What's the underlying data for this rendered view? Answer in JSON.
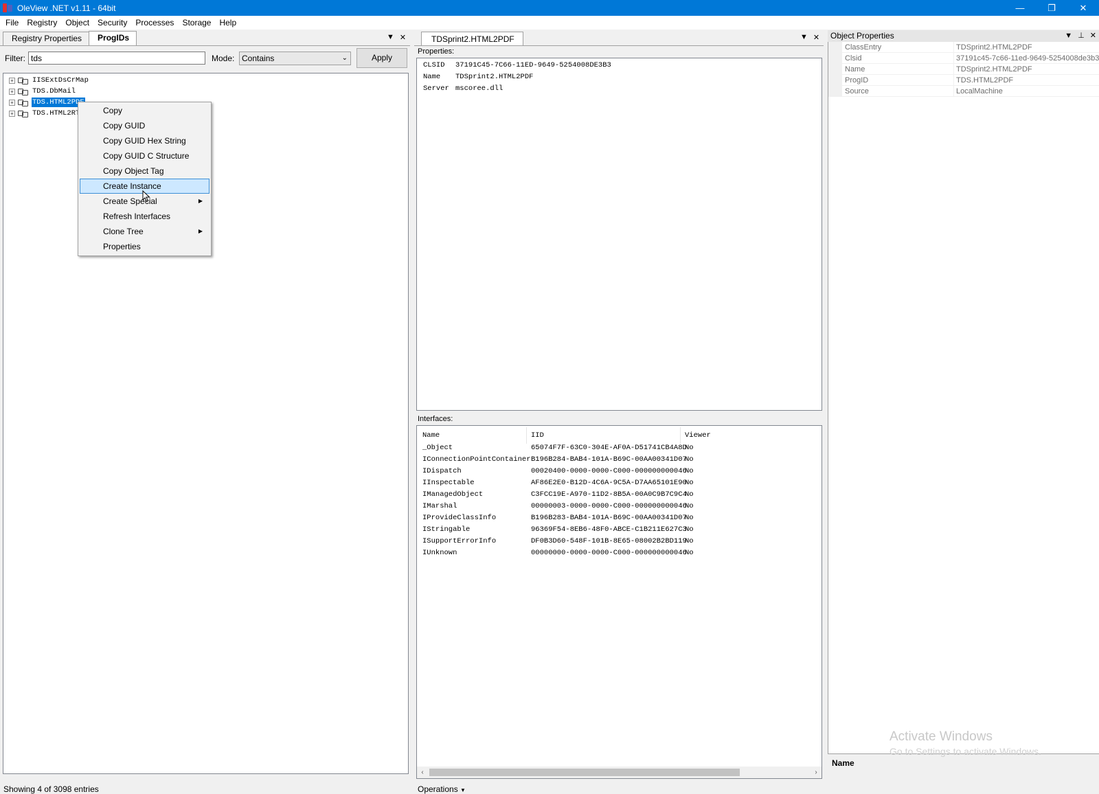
{
  "window": {
    "title": "OleView .NET v1.11 - 64bit",
    "minimize": "—",
    "restore": "❐",
    "close": "✕"
  },
  "menu": [
    "File",
    "Registry",
    "Object",
    "Security",
    "Processes",
    "Storage",
    "Help"
  ],
  "left": {
    "tabs": [
      "Registry Properties",
      "ProgIDs"
    ],
    "active_tab": "ProgIDs",
    "filter_label": "Filter:",
    "filter_value": "tds",
    "mode_label": "Mode:",
    "mode_value": "Contains",
    "apply_label": "Apply",
    "tree": [
      "IISExtDsCrMap",
      "TDS.DbMail",
      "TDS.HTML2PDF",
      "TDS.HTML2RTF"
    ],
    "selected_index": 2,
    "status": "Showing 4 of 3098 entries"
  },
  "context_menu": {
    "items": [
      {
        "label": "Copy",
        "submenu": false
      },
      {
        "label": "Copy GUID",
        "submenu": false
      },
      {
        "label": "Copy GUID Hex String",
        "submenu": false
      },
      {
        "label": "Copy GUID C Structure",
        "submenu": false
      },
      {
        "label": "Copy Object Tag",
        "submenu": false
      },
      {
        "label": "Create Instance",
        "submenu": false,
        "hover": true
      },
      {
        "label": "Create Special",
        "submenu": true
      },
      {
        "label": "Refresh Interfaces",
        "submenu": false
      },
      {
        "label": "Clone Tree",
        "submenu": true
      },
      {
        "label": "Properties",
        "submenu": false
      }
    ]
  },
  "middle": {
    "tab_title": "TDSprint2.HTML2PDF",
    "properties_label": "Properties:",
    "properties": [
      {
        "key": "CLSID",
        "value": "37191C45-7C66-11ED-9649-5254008DE3B3"
      },
      {
        "key": "Name",
        "value": "TDSprint2.HTML2PDF"
      },
      {
        "key": "Server",
        "value": "mscoree.dll"
      }
    ],
    "interfaces_label": "Interfaces:",
    "columns": [
      "Name",
      "IID",
      "Viewer"
    ],
    "interfaces": [
      [
        "_Object",
        "65074F7F-63C0-304E-AF0A-D51741CB4A8D",
        "No"
      ],
      [
        "IConnectionPointContainer",
        "B196B284-BAB4-101A-B69C-00AA00341D07",
        "No"
      ],
      [
        "IDispatch",
        "00020400-0000-0000-C000-000000000046",
        "No"
      ],
      [
        "IInspectable",
        "AF86E2E0-B12D-4C6A-9C5A-D7AA65101E90",
        "No"
      ],
      [
        "IManagedObject",
        "C3FCC19E-A970-11D2-8B5A-00A0C9B7C9C4",
        "No"
      ],
      [
        "IMarshal",
        "00000003-0000-0000-C000-000000000046",
        "No"
      ],
      [
        "IProvideClassInfo",
        "B196B283-BAB4-101A-B69C-00AA00341D07",
        "No"
      ],
      [
        "IStringable",
        "96369F54-8EB6-48F0-ABCE-C1B211E627C3",
        "No"
      ],
      [
        "ISupportErrorInfo",
        "DF0B3D60-548F-101B-8E65-08002B2BD119",
        "No"
      ],
      [
        "IUnknown",
        "00000000-0000-0000-C000-000000000046",
        "No"
      ]
    ],
    "operations_label": "Operations"
  },
  "right": {
    "title": "Object Properties",
    "rows": [
      {
        "key": "ClassEntry",
        "value": "TDSprint2.HTML2PDF"
      },
      {
        "key": "Clsid",
        "value": "37191c45-7c66-11ed-9649-5254008de3b3"
      },
      {
        "key": "Name",
        "value": "TDSprint2.HTML2PDF"
      },
      {
        "key": "ProgID",
        "value": "TDS.HTML2PDF"
      },
      {
        "key": "Source",
        "value": "LocalMachine"
      }
    ],
    "description_name": "Name"
  },
  "watermark": {
    "line1": "Activate Windows",
    "line2": "Go to Settings to activate Windows."
  }
}
